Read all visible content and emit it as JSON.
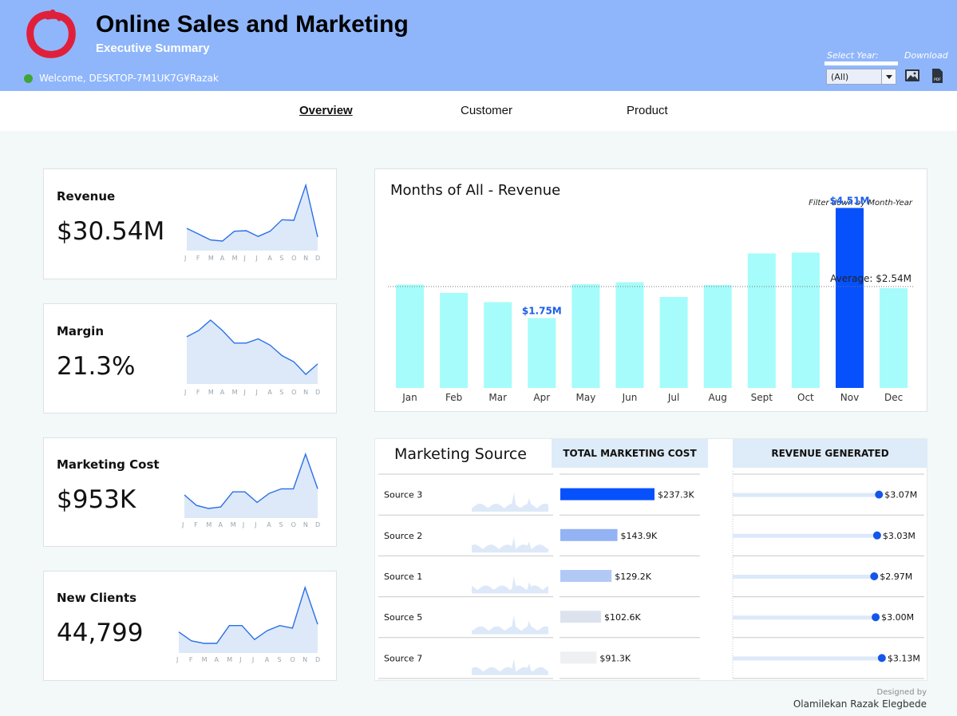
{
  "header": {
    "title": "Online Sales and Marketing",
    "subtitle": "Executive Summary",
    "welcome": "Welcome, DESKTOP-7M1UK7G¥Razak",
    "select_year_label": "Select Year:",
    "selected_year": "(All)",
    "download_label": "Download",
    "logo_color": "#e0203a",
    "header_color": "#8fb6fb"
  },
  "nav": {
    "tabs": [
      {
        "label": "Overview",
        "active": true
      },
      {
        "label": "Customer",
        "active": false
      },
      {
        "label": "Product",
        "active": false
      }
    ]
  },
  "kpis": [
    {
      "label": "Revenue",
      "value": "$30.54M",
      "trend": [
        10,
        9,
        8,
        7.8,
        9.5,
        9.6,
        8.6,
        9.5,
        11.5,
        11.4,
        17.5,
        8.5
      ]
    },
    {
      "label": "Margin",
      "value": "21.3%",
      "trend": [
        24,
        24.3,
        24.8,
        24.3,
        23.7,
        23.7,
        23.9,
        23.6,
        23.1,
        22.8,
        22.2,
        22.7
      ]
    },
    {
      "label": "Marketing Cost",
      "value": "$953K",
      "trend": [
        75,
        68,
        66,
        67,
        77,
        77,
        70,
        76,
        79,
        79,
        102,
        79
      ]
    },
    {
      "label": "New Clients",
      "value": "44,799",
      "trend": [
        3500,
        3150,
        3050,
        3050,
        3750,
        3750,
        3200,
        3550,
        3750,
        3650,
        5250,
        3800
      ]
    }
  ],
  "month_letters": [
    "J",
    "F",
    "M",
    "A",
    "M",
    "J",
    "J",
    "A",
    "S",
    "O",
    "N",
    "D"
  ],
  "revenue_chart": {
    "title": "Months of All - Revenue",
    "note": "Filter down by Month-Year",
    "average_label": "Average: $2.54M",
    "bar_color": "#a6fcfa",
    "highlight_color": "#0651fb",
    "label_color": "#1a5ee8",
    "chart_data": {
      "type": "bar",
      "categories": [
        "Jan",
        "Feb",
        "Mar",
        "Apr",
        "May",
        "Jun",
        "Jul",
        "Aug",
        "Sept",
        "Oct",
        "Nov",
        "Dec"
      ],
      "values": [
        2.59,
        2.38,
        2.15,
        1.75,
        2.6,
        2.65,
        2.28,
        2.58,
        3.37,
        3.39,
        4.51,
        2.5
      ],
      "data_labels": {
        "3": "$1.75M",
        "10": "$4.51M"
      },
      "highlight_index": 10,
      "average": 2.54,
      "ylim": [
        0,
        5
      ]
    }
  },
  "marketing": {
    "title": "Marketing Source",
    "cost_header": "TOTAL MARKETING COST",
    "revenue_header": "REVENUE GENERATED",
    "sources": [
      {
        "name": "Source 3",
        "cost": 237.3,
        "cost_label": "$237.3K",
        "cost_color": "#0651fb",
        "revenue": 3.07,
        "revenue_label": "$3.07M"
      },
      {
        "name": "Source 2",
        "cost": 143.9,
        "cost_label": "$143.9K",
        "cost_color": "#93b3f5",
        "revenue": 3.03,
        "revenue_label": "$3.03M"
      },
      {
        "name": "Source 1",
        "cost": 129.2,
        "cost_label": "$129.2K",
        "cost_color": "#b3c9f5",
        "revenue": 2.97,
        "revenue_label": "$2.97M"
      },
      {
        "name": "Source 5",
        "cost": 102.6,
        "cost_label": "$102.6K",
        "cost_color": "#dce3ef",
        "revenue": 3.0,
        "revenue_label": "$3.00M"
      },
      {
        "name": "Source 7",
        "cost": 91.3,
        "cost_label": "$91.3K",
        "cost_color": "#eef0f2",
        "revenue": 3.13,
        "revenue_label": "$3.13M"
      }
    ]
  },
  "footer": {
    "designed_by": "Designed by",
    "author": "Olamilekan Razak Elegbede"
  }
}
